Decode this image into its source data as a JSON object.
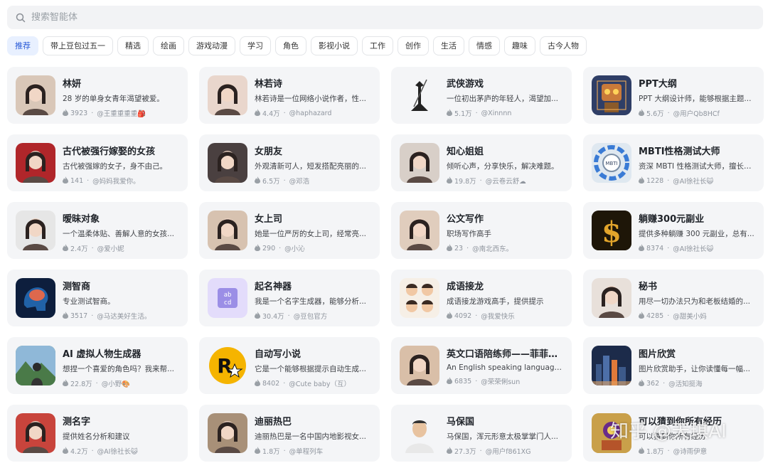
{
  "search": {
    "placeholder": "搜索智能体"
  },
  "tabs": [
    "推荐",
    "带上豆包过五一",
    "精选",
    "绘画",
    "游戏动漫",
    "学习",
    "角色",
    "影视小说",
    "工作",
    "创作",
    "生活",
    "情感",
    "趣味",
    "古今人物"
  ],
  "cards": [
    {
      "title": "林妍",
      "desc": "28 岁的单身女青年渴望被爱。",
      "count": "3923",
      "author": "@王重重重重🎒",
      "avatar_bg": "#d9c7b8",
      "avatar_icon": "portrait"
    },
    {
      "title": "林若诗",
      "desc": "林若诗是一位网络小说作者，性...",
      "count": "4.4万",
      "author": "@haphazard",
      "avatar_bg": "#e9d6cc",
      "avatar_icon": "portrait"
    },
    {
      "title": "武侠游戏",
      "desc": "一位初出茅庐的年轻人，渴望加...",
      "count": "5.1万",
      "author": "@Xinnnn",
      "avatar_bg": "#f4f5f7",
      "avatar_icon": "swordsman"
    },
    {
      "title": "PPT大纲",
      "desc": "PPT 大纲设计师，能够根据主题...",
      "count": "5.6万",
      "author": "@用户Qb8HCf",
      "avatar_bg": "#2f3e66",
      "avatar_icon": "robot"
    },
    {
      "title": "古代被强行嫁娶的女孩",
      "desc": "古代被强嫁的女子，身不由己。",
      "count": "141",
      "author": "@妈妈我爱你。",
      "avatar_bg": "#b0262a",
      "avatar_icon": "portrait"
    },
    {
      "title": "女朋友",
      "desc": "外观清新可人，短发搭配亮丽的...",
      "count": "6.5万",
      "author": "@邓浩",
      "avatar_bg": "#4a4040",
      "avatar_icon": "portrait"
    },
    {
      "title": "知心姐姐",
      "desc": "倾听心声，分享快乐，解决难题。",
      "count": "19.8万",
      "author": "@云卷云舒☁",
      "avatar_bg": "#d8cfc8",
      "avatar_icon": "portrait"
    },
    {
      "title": "MBTI性格测试大师",
      "desc": "资深 MBTI 性格测试大师，擅长通...",
      "count": "1228",
      "author": "@AI徐社长😺",
      "avatar_bg": "#dfe8f0",
      "avatar_icon": "mbti"
    },
    {
      "title": "暧昧对象",
      "desc": "一个温柔体贴、善解人意的女孩...",
      "count": "2.4万",
      "author": "@爱小妮",
      "avatar_bg": "#e6e6e6",
      "avatar_icon": "portrait"
    },
    {
      "title": "女上司",
      "desc": "她是一位严厉的女上司，经常亮...",
      "count": "290",
      "author": "@小沁",
      "avatar_bg": "#d7c2b0",
      "avatar_icon": "portrait"
    },
    {
      "title": "公文写作",
      "desc": "职场写作高手",
      "count": "23",
      "author": "@南北西东。",
      "avatar_bg": "#e0cdbd",
      "avatar_icon": "portrait"
    },
    {
      "title": "躺赚300元副业",
      "desc": "提供多种躺赚 300 元副业，总有...",
      "count": "8374",
      "author": "@AI徐社长😺",
      "avatar_bg": "#1e1608",
      "avatar_icon": "dollar"
    },
    {
      "title": "测智商",
      "desc": "专业测试智商。",
      "count": "3517",
      "author": "@马达美好生活。",
      "avatar_bg": "#0d1e3d",
      "avatar_icon": "brain"
    },
    {
      "title": "起名神器",
      "desc": "我是一个名字生成器，能够分析...",
      "count": "30.4万",
      "author": "@豆包官方",
      "avatar_bg": "#e3dcfb",
      "avatar_icon": "abcd"
    },
    {
      "title": "成语接龙",
      "desc": "成语接龙游戏高手，提供提示",
      "count": "4092",
      "author": "@我爱快乐",
      "avatar_bg": "#f6efe6",
      "avatar_icon": "kids"
    },
    {
      "title": "秘书",
      "desc": "用尽一切办法只为和老板结婚的...",
      "count": "4285",
      "author": "@甜美小妈",
      "avatar_bg": "#e8e0da",
      "avatar_icon": "portrait"
    },
    {
      "title": "AI 虚拟人物生成器",
      "desc": "想捏一个喜爱的角色吗？我来帮...",
      "count": "22.8万",
      "author": "@小野🎨",
      "avatar_bg": "#5d8f5a",
      "avatar_icon": "landscape"
    },
    {
      "title": "自动写小说",
      "desc": "它是一个能够根据提示自动生成...",
      "count": "8402",
      "author": "@Cute baby（互）",
      "avatar_bg": "#f4f5f7",
      "avatar_icon": "rstar"
    },
    {
      "title": "英文口语陪练师——菲菲老师",
      "desc": "An English speaking language pa...",
      "count": "6835",
      "author": "@荣荣俐sun",
      "avatar_bg": "#d9bfa8",
      "avatar_icon": "portrait"
    },
    {
      "title": "图片欣赏",
      "desc": "图片欣赏助手，让你读懂每一幅...",
      "count": "362",
      "author": "@活知挺海",
      "avatar_bg": "#1c2b4a",
      "avatar_icon": "city"
    },
    {
      "title": "测名字",
      "desc": "提供姓名分析和建议",
      "count": "4.2万",
      "author": "@AI徐社长😺",
      "avatar_bg": "#c8443c",
      "avatar_icon": "portrait"
    },
    {
      "title": "迪丽热巴",
      "desc": "迪丽热巴是一名中国内地影视女...",
      "count": "1.8万",
      "author": "@单程列车",
      "avatar_bg": "#a89078",
      "avatar_icon": "portrait"
    },
    {
      "title": "马保国",
      "desc": "马保国，浑元形意太极掌掌门人...",
      "count": "27.3万",
      "author": "@用户f861XG",
      "avatar_bg": "#f4f5f7",
      "avatar_icon": "man"
    },
    {
      "title": "可以猜到你所有经历",
      "desc": "可以猜到你所有经历",
      "count": "1.8万",
      "author": "@诗雨伊意",
      "avatar_bg": "#c9a04a",
      "avatar_icon": "art"
    }
  ],
  "watermark": "知乎 @天琪AI"
}
